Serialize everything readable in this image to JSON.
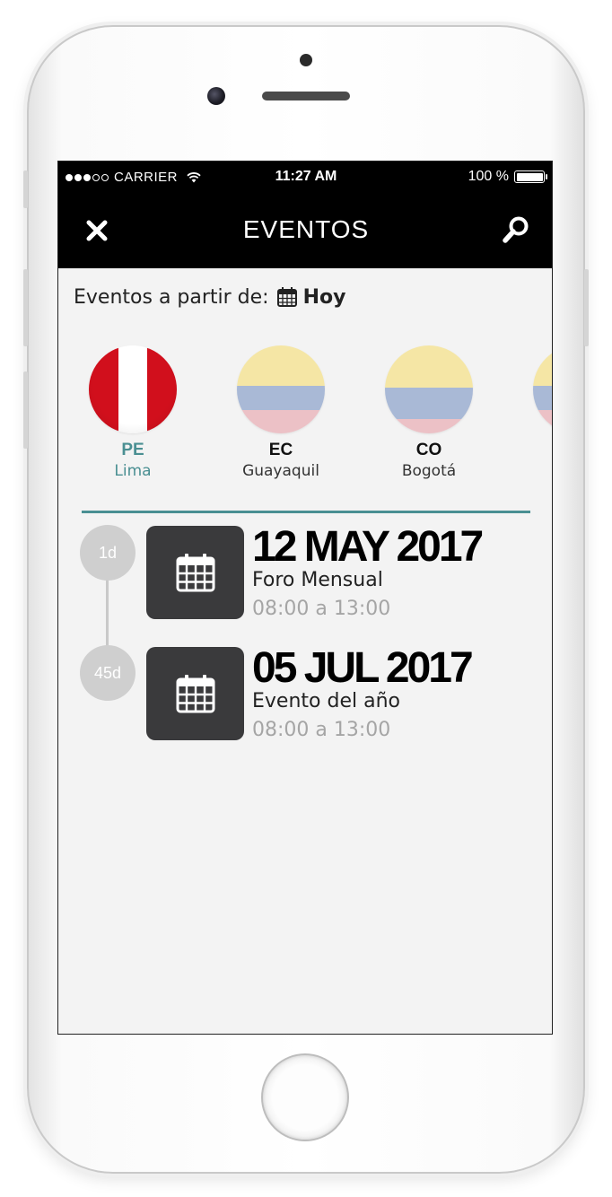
{
  "status_bar": {
    "carrier": "CARRIER",
    "time": "11:27 AM",
    "battery": "100 %",
    "battery_level": 1.0
  },
  "nav": {
    "title": "EVENTOS",
    "close_icon": "close-icon",
    "search_icon": "search-icon"
  },
  "filter": {
    "label": "Eventos a partir de:",
    "icon": "calendar-icon",
    "value": "Hoy"
  },
  "countries": [
    {
      "code": "PE",
      "city": "Lima",
      "selected": true,
      "flag_colors": [
        "#d10f1c",
        "#ffffff",
        "#d10f1c"
      ]
    },
    {
      "code": "EC",
      "city": "Guayaquil",
      "selected": false,
      "flag_colors": [
        "#f5e6a5",
        "#a9b9d6",
        "#ecc1c6"
      ]
    },
    {
      "code": "CO",
      "city": "Bogotá",
      "selected": false,
      "flag_colors": [
        "#f5e6a5",
        "#a9b9d6",
        "#ecc1c6"
      ]
    }
  ],
  "events": [
    {
      "badge": "1d",
      "date": "12 MAY 2017",
      "name": "Foro Mensual",
      "time": "08:00 a 13:00",
      "icon": "calendar-icon"
    },
    {
      "badge": "45d",
      "date": "05 JUL 2017",
      "name": "Evento del año",
      "time": "08:00 a 13:00",
      "icon": "calendar-icon"
    }
  ],
  "colors": {
    "accent": "#4a8f92",
    "navbar": "#000000",
    "screen_bg": "#f3f3f3",
    "event_icon_bg": "#3a3a3c",
    "badge_bg": "#cfcfcf"
  }
}
